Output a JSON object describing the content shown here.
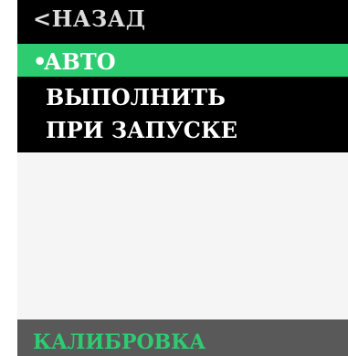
{
  "menu": {
    "back_label": "<НАЗАД",
    "selected": {
      "bullet": "•",
      "label": "АВТО"
    },
    "items": [
      {
        "label": "ВЫПОЛНИТЬ"
      },
      {
        "label": "ПРИ ЗАПУСКЕ"
      }
    ]
  },
  "footer": {
    "title": "КАЛИБРОВКА"
  },
  "colors": {
    "menu_background": "#000000",
    "selected_background": "#2ecc71",
    "content_background": "#f5f5f5",
    "footer_background": "#595959",
    "footer_text": "#2ecc71"
  }
}
